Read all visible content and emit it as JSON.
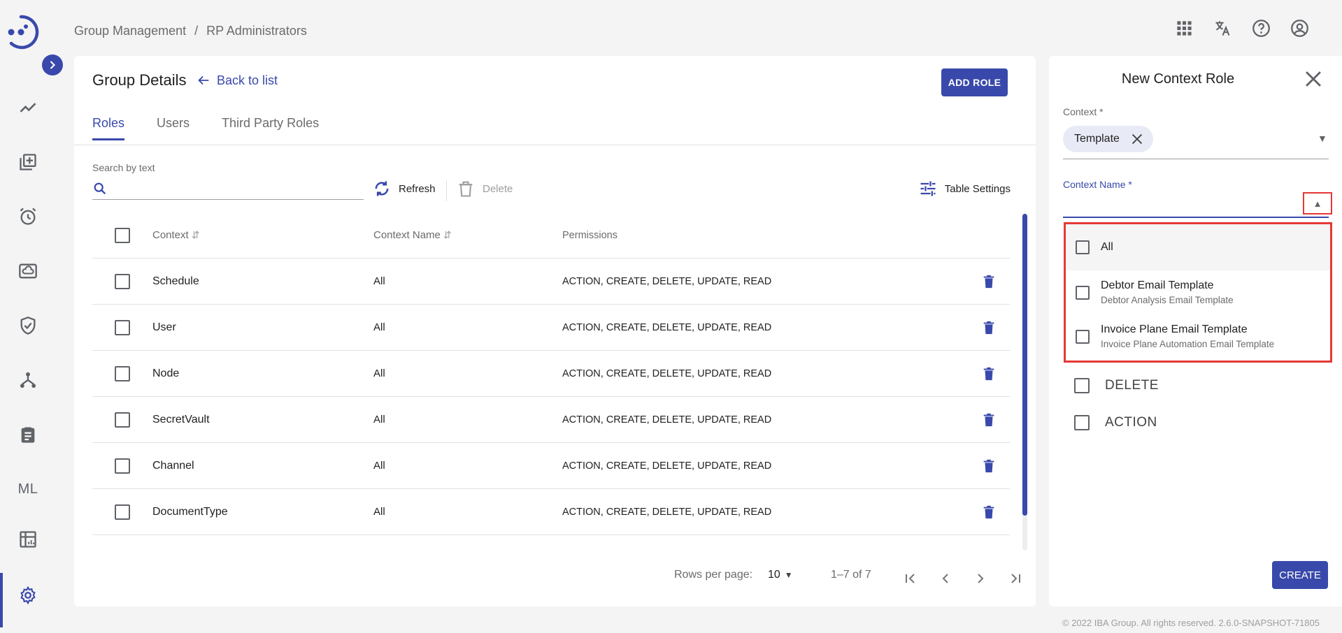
{
  "breadcrumb": {
    "parent": "Group Management",
    "separator": "/",
    "current": "RP Administrators"
  },
  "card": {
    "title": "Group Details",
    "back_link": "Back to list",
    "add_role": "ADD ROLE",
    "tabs": [
      {
        "label": "Roles",
        "active": true
      },
      {
        "label": "Users",
        "active": false
      },
      {
        "label": "Third Party Roles",
        "active": false
      }
    ],
    "search_label": "Search by text",
    "search_value": "",
    "refresh": "Refresh",
    "delete": "Delete",
    "table_settings": "Table Settings",
    "columns": {
      "context": "Context",
      "context_name": "Context Name",
      "permissions": "Permissions"
    },
    "rows": [
      {
        "context": "Schedule",
        "context_name": "All",
        "permissions": "ACTION, CREATE, DELETE, UPDATE, READ"
      },
      {
        "context": "User",
        "context_name": "All",
        "permissions": "ACTION, CREATE, DELETE, UPDATE, READ"
      },
      {
        "context": "Node",
        "context_name": "All",
        "permissions": "ACTION, CREATE, DELETE, UPDATE, READ"
      },
      {
        "context": "SecretVault",
        "context_name": "All",
        "permissions": "ACTION, CREATE, DELETE, UPDATE, READ"
      },
      {
        "context": "Channel",
        "context_name": "All",
        "permissions": "ACTION, CREATE, DELETE, UPDATE, READ"
      },
      {
        "context": "DocumentType",
        "context_name": "All",
        "permissions": "ACTION, CREATE, DELETE, UPDATE, READ"
      }
    ],
    "pager": {
      "rows_per_page_label": "Rows per page:",
      "rows_per_page": "10",
      "range": "1–7 of 7"
    }
  },
  "panel": {
    "title": "New Context Role",
    "context_label": "Context *",
    "context_chip": "Template",
    "context_name_label": "Context Name *",
    "dropdown": {
      "all": "All",
      "items": [
        {
          "name": "Debtor Email Template",
          "description": "Debtor Analysis Email Template"
        },
        {
          "name": "Invoice Plane Email Template",
          "description": "Invoice Plane Automation Email Template"
        }
      ]
    },
    "permissions": [
      "DELETE",
      "ACTION"
    ],
    "create": "CREATE"
  },
  "footer": "© 2022 IBA Group. All rights reserved. 2.6.0-SNAPSHOT-71805",
  "nav": {
    "ml_label": "ML"
  },
  "icons": [
    "logo-icon",
    "chevron-right-icon",
    "trend-icon",
    "library-add-icon",
    "alarm-icon",
    "cloud-storage-icon",
    "shield-check-icon",
    "hierarchy-icon",
    "clipboard-icon",
    "table-chart-icon",
    "gear-icon",
    "apps-grid-icon",
    "translate-icon",
    "help-icon",
    "account-icon"
  ],
  "colors": {
    "accent": "#3949ab",
    "highlight_box": "#e53935"
  }
}
